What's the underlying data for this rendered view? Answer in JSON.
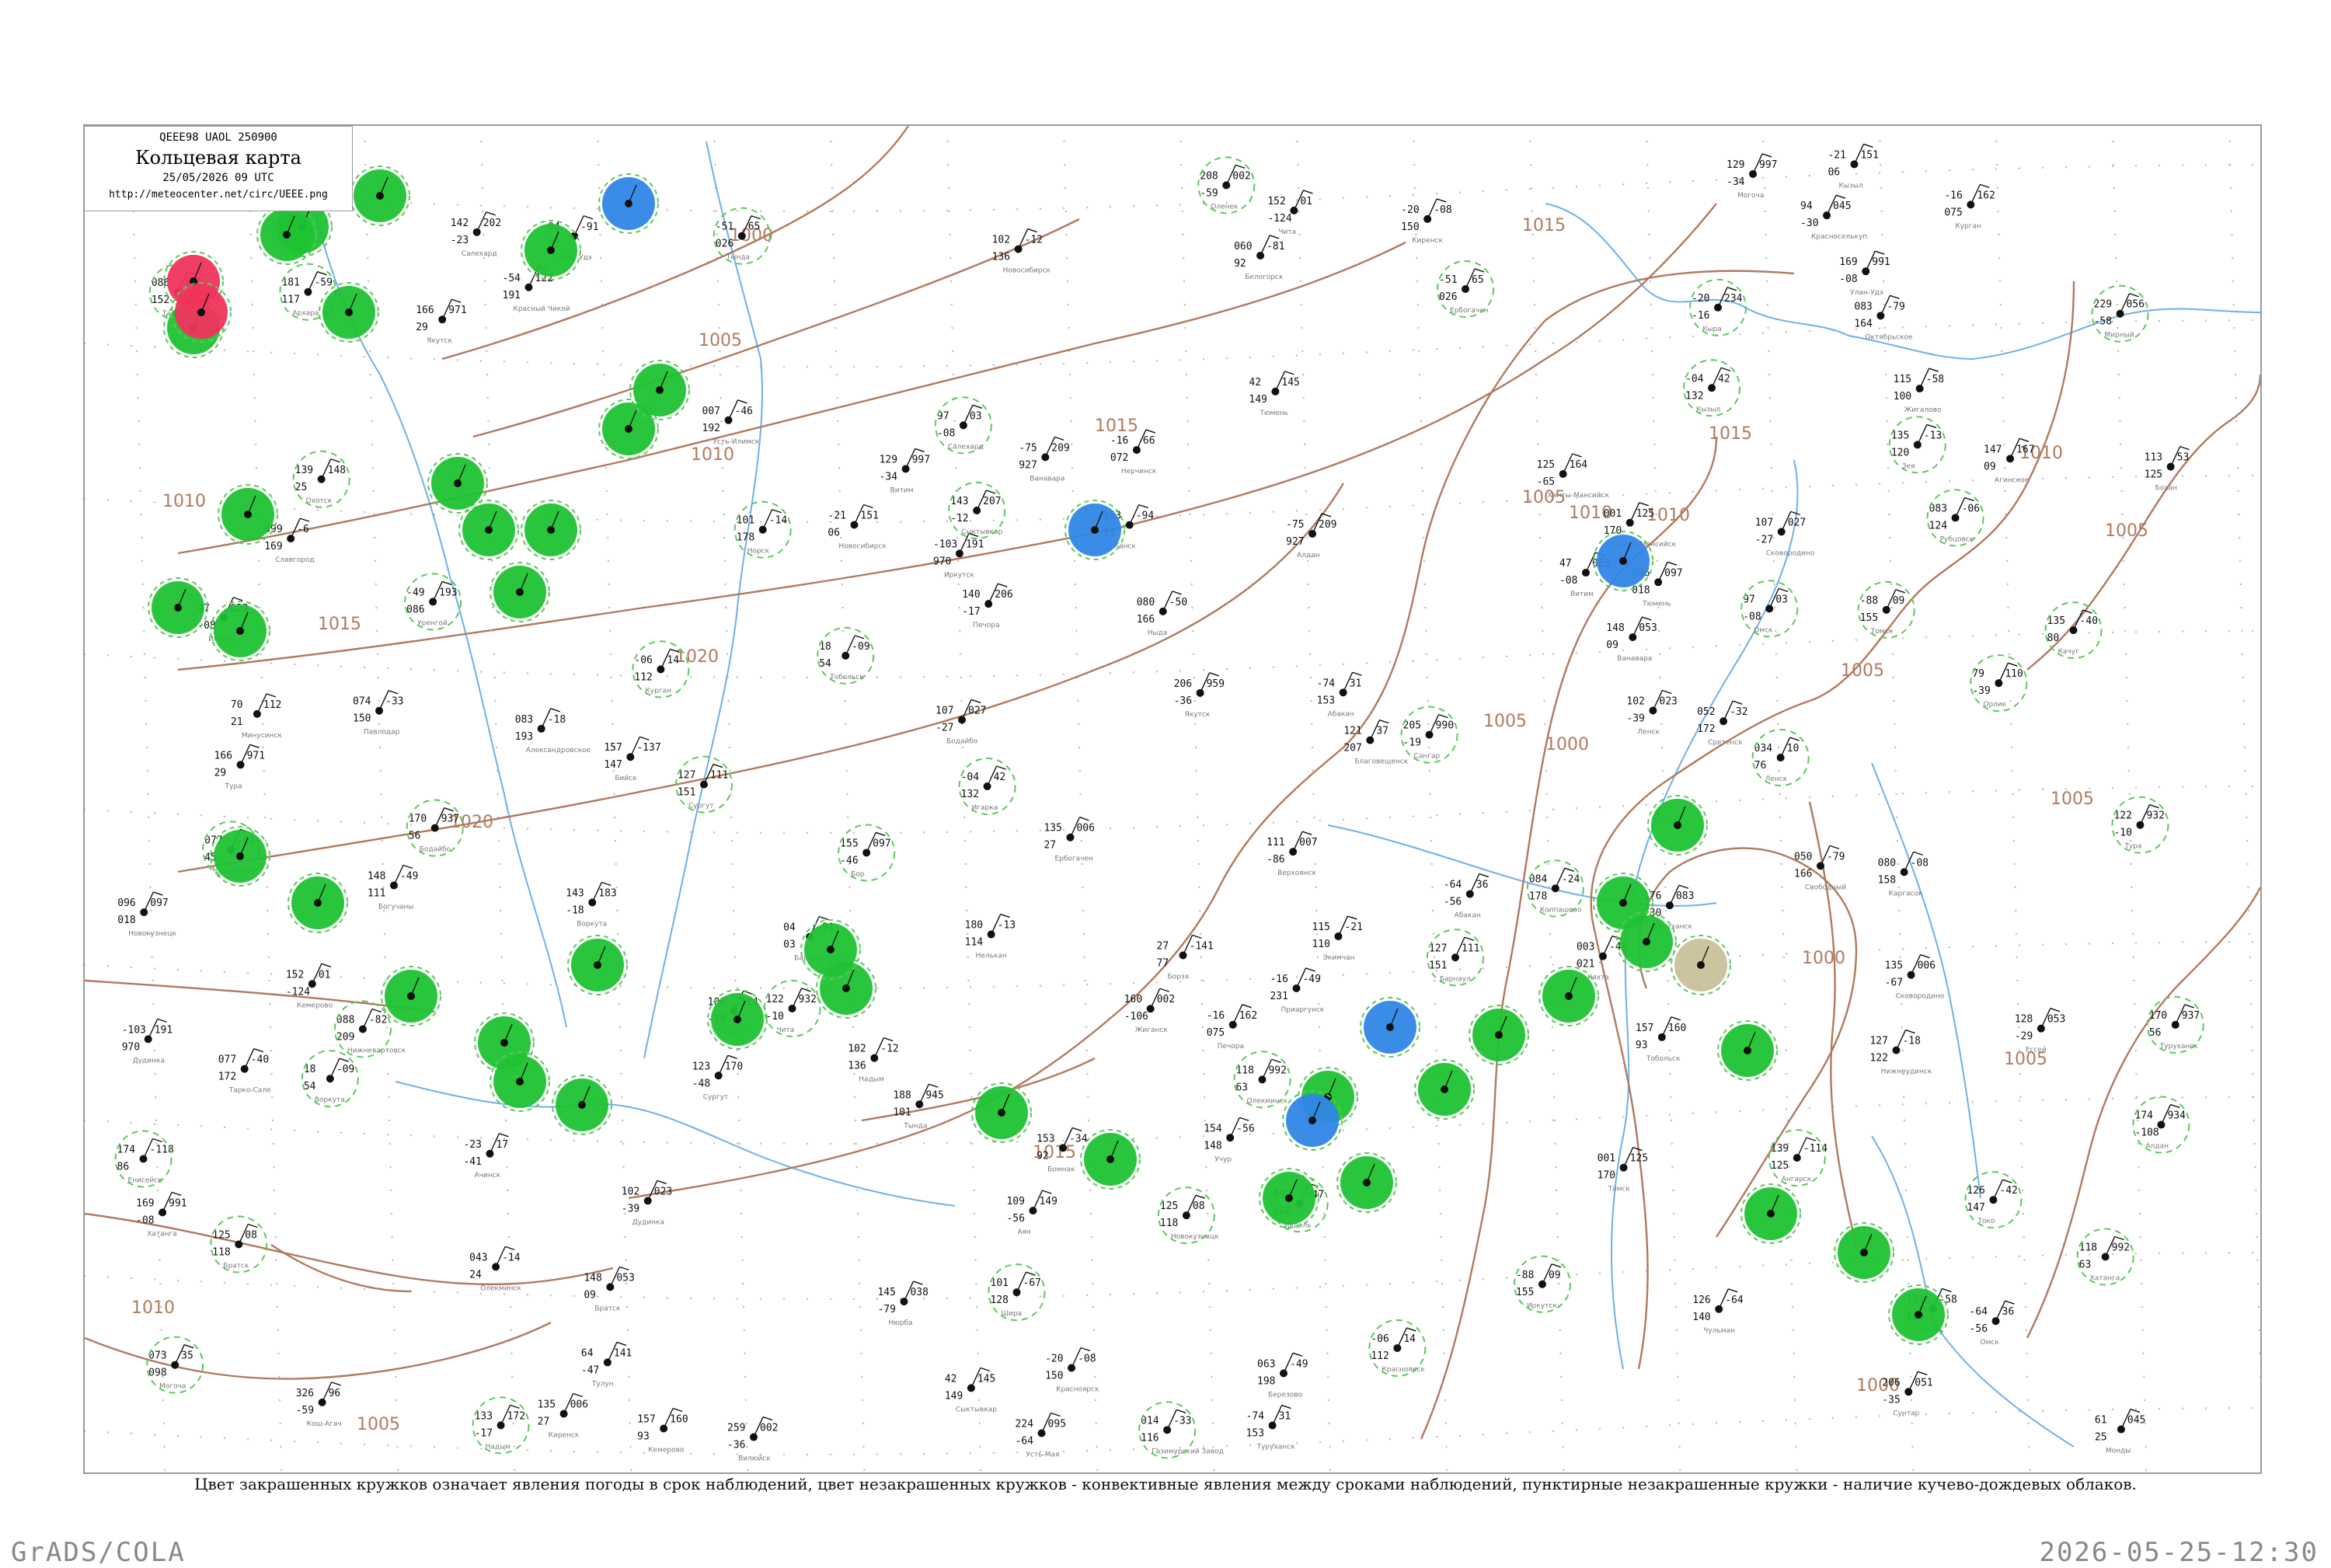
{
  "header": {
    "code": "QEEE98  UAOL  250900",
    "title": "Кольцевая карта",
    "date": "25/05/2026 09 UTC",
    "url": "http://meteocenter.net/circ/UEEE.png"
  },
  "caption": "Цвет закрашенных кружков означает явления погоды в срок наблюдений, цвет незакрашенных кружков - конвективные явления между сроками наблюдений, пунктирные незакрашенные кружки - наличие кучево-дождевых облаков.",
  "footer": {
    "software": "GrADS/COLA",
    "timestamp": "2026-05-25-12:30"
  },
  "colors": {
    "isobar": "#b07a5e",
    "river": "#6fb0e8",
    "precip_fill": "#1ec232",
    "snow_fill": "#2f86e6",
    "thunder_fill": "#f0345c",
    "fog_fill": "#c9c09a",
    "cb_dashed": "#5cc85c"
  },
  "isobar_labels": [
    "1000",
    "1005",
    "1010",
    "1015",
    "1020",
    "1005",
    "1010",
    "1015",
    "1010",
    "1015",
    "1010",
    "1005",
    "1005",
    "1005",
    "1000",
    "1000",
    "1005",
    "1010",
    "1015",
    "1015",
    "1020",
    "1010",
    "1005",
    "1000",
    "1005"
  ],
  "filled_stations": [
    {
      "type": "precip"
    },
    {
      "type": "precip"
    },
    {
      "type": "precip"
    },
    {
      "type": "precip"
    },
    {
      "type": "precip"
    },
    {
      "type": "precip"
    },
    {
      "type": "precip"
    },
    {
      "type": "precip"
    },
    {
      "type": "precip"
    },
    {
      "type": "precip"
    },
    {
      "type": "precip"
    },
    {
      "type": "precip"
    },
    {
      "type": "precip"
    },
    {
      "type": "precip"
    },
    {
      "type": "precip"
    },
    {
      "type": "precip"
    },
    {
      "type": "precip"
    },
    {
      "type": "precip"
    },
    {
      "type": "precip"
    },
    {
      "type": "precip"
    },
    {
      "type": "precip"
    },
    {
      "type": "precip"
    },
    {
      "type": "precip"
    },
    {
      "type": "precip"
    },
    {
      "type": "precip"
    },
    {
      "type": "precip"
    },
    {
      "type": "precip"
    },
    {
      "type": "precip"
    },
    {
      "type": "precip"
    },
    {
      "type": "precip"
    },
    {
      "type": "precip"
    },
    {
      "type": "precip"
    },
    {
      "type": "precip"
    },
    {
      "type": "precip"
    },
    {
      "type": "precip"
    },
    {
      "type": "precip"
    },
    {
      "type": "precip"
    },
    {
      "type": "precip"
    },
    {
      "type": "precip"
    },
    {
      "type": "precip"
    },
    {
      "type": "snow"
    },
    {
      "type": "snow"
    },
    {
      "type": "snow"
    },
    {
      "type": "snow"
    },
    {
      "type": "snow"
    },
    {
      "type": "thunder"
    },
    {
      "type": "thunder"
    },
    {
      "type": "fog"
    }
  ],
  "station_numbers": [
    "18",
    "-09",
    "54",
    "42",
    "145",
    "149",
    "-16",
    "162",
    "075",
    "97",
    "03",
    "-08",
    "102",
    "-12",
    "136",
    "001",
    "125",
    "170",
    "127",
    "111",
    "151",
    "157",
    "160",
    "93",
    "096",
    "097",
    "018",
    "-06",
    "14",
    "112",
    "-64",
    "36",
    "-56",
    "-21",
    "151",
    "06",
    "-88",
    "09",
    "155",
    "04",
    "-91",
    "03",
    "152",
    "01",
    "-124",
    "125",
    "08",
    "118",
    "-20",
    "-08",
    "150",
    "-74",
    "31",
    "153",
    "-04",
    "42",
    "132",
    "-103",
    "191",
    "970",
    "169",
    "991",
    "-08",
    "122",
    "932",
    "-10",
    "148",
    "053",
    "09",
    "135",
    "006",
    "27",
    "170",
    "937",
    "56",
    "47",
    "023",
    "-08",
    "102",
    "023",
    "-39",
    "118",
    "992",
    "63",
    "166",
    "971",
    "29",
    "-75",
    "209",
    "927",
    "-51",
    "65",
    "026",
    "107",
    "027",
    "-27",
    "129",
    "997",
    "-34",
    "034",
    "10",
    "76",
    "043",
    "-14",
    "24",
    "206",
    "959",
    "-36",
    "174",
    "934",
    "-108",
    "188",
    "945",
    "101",
    "135",
    "006",
    "-67",
    "073",
    "35",
    "098",
    "-16",
    "66",
    "072",
    "27",
    "-141",
    "77",
    "077",
    "-01",
    "45",
    "003",
    "-48",
    "021",
    "61",
    "045",
    "25",
    "79",
    "110",
    "-39",
    "64",
    "141",
    "-47",
    "163",
    "-94",
    "21",
    "174",
    "-118",
    "86",
    "148",
    "-49",
    "111",
    "151",
    "-58",
    "133",
    "139",
    "-114",
    "125",
    "007",
    "-46",
    "192",
    "115",
    "-58",
    "100",
    "135",
    "-40",
    "80",
    "113",
    "53",
    "125",
    "127",
    "-18",
    "122",
    "086",
    "109",
    "152",
    "-23",
    "17",
    "-41",
    "70",
    "112",
    "21",
    "101",
    "-67",
    "128",
    "326",
    "96",
    "-59",
    "157",
    "-137",
    "147",
    "083",
    "-06",
    "124",
    "099",
    "-6",
    "169",
    "074",
    "-33",
    "150",
    "084",
    "-24",
    "178",
    "080",
    "-08",
    "158",
    "083",
    "-18",
    "193",
    "088",
    "-82",
    "209",
    "063",
    "-49",
    "198",
    "083",
    "-79",
    "164",
    "097",
    "-47",
    "168",
    "080",
    "-50",
    "166",
    "077",
    "-40",
    "172",
    "-49",
    "193",
    "086",
    "94",
    "045",
    "-30",
    "176",
    "083",
    "-30",
    "155",
    "097",
    "-46",
    "106",
    "114",
    "-18",
    "128",
    "053",
    "-29",
    "208",
    "002",
    "-59",
    "160",
    "002",
    "-106",
    "111",
    "007",
    "-86",
    "205",
    "990",
    "-19",
    "259",
    "002",
    "-36",
    "145",
    "038",
    "-79",
    "229",
    "056",
    "-58",
    "206",
    "051",
    "-35",
    "224",
    "095",
    "-64",
    "139",
    "148",
    "25",
    "109",
    "149",
    "-56",
    "126",
    "-64",
    "140",
    "126",
    "-42",
    "147",
    "180",
    "-13",
    "114",
    "154",
    "-56",
    "148",
    "135",
    "-13",
    "120",
    "153",
    "-34",
    "92",
    "115",
    "-21",
    "110",
    "101",
    "-14",
    "178",
    "050",
    "-79",
    "166",
    "121",
    "37",
    "207",
    "181",
    "-59",
    "117",
    "060",
    "-81",
    "92",
    "052",
    "-32",
    "172",
    "014",
    "-33",
    "116",
    "-16",
    "-49",
    "231",
    "-54",
    "122",
    "191",
    "-20",
    "234",
    "-16",
    "147",
    "167",
    "09",
    "143",
    "183",
    "-18",
    "143",
    "207",
    "-12",
    "140",
    "206",
    "-17",
    "142",
    "202",
    "-23",
    "133",
    "172",
    "-17",
    "125",
    "164",
    "-65",
    "123",
    "170",
    "-48"
  ],
  "station_names": [
    "Воркута",
    "Сыктывкар",
    "Печора",
    "Салехард",
    "Надым",
    "Ханты-Мансийск",
    "Сургут",
    "Тобольск",
    "Тюмень",
    "Курган",
    "Омск",
    "Новосибирск",
    "Томск",
    "Барнаул",
    "Кемерово",
    "Новокузнецк",
    "Красноярск",
    "Абакан",
    "Кызыл",
    "Иркутск",
    "Улан-Удэ",
    "Чита",
    "Братск",
    "Киренск",
    "Туруханск",
    "Игарка",
    "Дудинка",
    "Хатанга",
    "Тура",
    "Ванавара",
    "Ербогачен",
    "Бодайбо",
    "Витим",
    "Ленск",
    "Олекминск",
    "Якутск",
    "Алдан",
    "Тында",
    "Сковородино",
    "Могоча",
    "Нерчинск",
    "Борзя",
    "Оловянная",
    "Кяхта",
    "Монды",
    "Орлик",
    "Тулун",
    "Канск",
    "Енисейск",
    "Богучаны",
    "Кежма",
    "Ангарск",
    "Усть-Илимск",
    "Жигалово",
    "Качуг",
    "Бохан",
    "Нижнеудинск",
    "Тайшет",
    "Ачинск",
    "Минусинск",
    "Шира",
    "Кош-Агач",
    "Бийск",
    "Рубцовск",
    "Славгород",
    "Павлодар",
    "Колпашево",
    "Каргасок",
    "Александровское",
    "Нижневартовск",
    "Березово",
    "Октябрьское",
    "Ивдель",
    "Ныда",
    "Тарко-Сале",
    "Уренгой",
    "Красноселькуп",
    "Туруханск",
    "Бор",
    "Байкит",
    "Ессей",
    "Оленек",
    "Жиганск",
    "Верхоянск",
    "Сангар",
    "Вилюйск",
    "Нюрба",
    "Мирный",
    "Сунтар",
    "Усть-Мая",
    "Охотск",
    "Аян",
    "Чульман",
    "Токо",
    "Нелькан",
    "Учур",
    "Зея",
    "Бомнак",
    "Экимчан",
    "Норск",
    "Свободный",
    "Благовещенск",
    "Архара",
    "Белогорск",
    "Сретенск",
    "Газимурский Завод",
    "Приаргунск",
    "Красный Чикой",
    "Кыра",
    "Агинское"
  ]
}
